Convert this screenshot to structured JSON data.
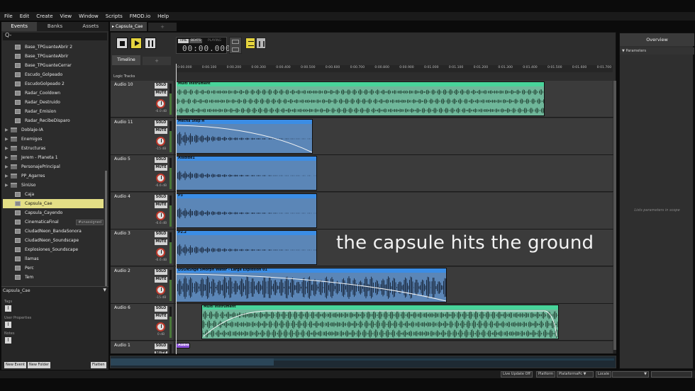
{
  "menu": [
    "File",
    "Edit",
    "Create",
    "View",
    "Window",
    "Scripts",
    "FMOD.io",
    "Help"
  ],
  "left_tabs": [
    "Events",
    "Banks",
    "Assets"
  ],
  "search_glyph": "Q-",
  "tree": [
    {
      "label": "Base_TPGuanteAbrir 2",
      "kind": "event"
    },
    {
      "label": "Base_TPGuanteAbrir",
      "kind": "event"
    },
    {
      "label": "Base_TPGuanteCerrar",
      "kind": "event"
    },
    {
      "label": "Escudo_Golpeado",
      "kind": "event"
    },
    {
      "label": "EscudoGolpeado 2",
      "kind": "event"
    },
    {
      "label": "Radar_Cooldown",
      "kind": "event"
    },
    {
      "label": "Radar_Destruido",
      "kind": "event"
    },
    {
      "label": "Radar_Emision",
      "kind": "event"
    },
    {
      "label": "Radar_RecibeDisparo",
      "kind": "event"
    },
    {
      "label": "Doblaje-IA",
      "kind": "folder"
    },
    {
      "label": "Enemigos",
      "kind": "folder"
    },
    {
      "label": "Estructuras",
      "kind": "folder"
    },
    {
      "label": "Jerem - Planeta 1",
      "kind": "folder"
    },
    {
      "label": "PersonajePrincipal",
      "kind": "folder"
    },
    {
      "label": "PP_Agarres",
      "kind": "folder"
    },
    {
      "label": "SinUso",
      "kind": "folder"
    },
    {
      "label": "Caja",
      "kind": "event"
    },
    {
      "label": "Capsula_Cae",
      "kind": "event",
      "selected": true
    },
    {
      "label": "Capsula_Cayendo",
      "kind": "event"
    },
    {
      "label": "CinematicaFinal",
      "kind": "event",
      "badge": "#unassigned"
    },
    {
      "label": "CiudadNeon_BandaSonora",
      "kind": "event"
    },
    {
      "label": "CiudadNeon_Soundscape",
      "kind": "event"
    },
    {
      "label": "Explosiones_Soundscape",
      "kind": "event"
    },
    {
      "label": "llamas",
      "kind": "event"
    },
    {
      "label": "Perc",
      "kind": "event"
    },
    {
      "label": "Tem",
      "kind": "event"
    }
  ],
  "props": {
    "title": "Capsula_Cae",
    "tags_label": "Tags",
    "user_props_label": "User Properties",
    "notes_label": "Notes",
    "add_glyph": "I"
  },
  "left_buttons": [
    "New Event",
    "New Folder",
    "Flatten"
  ],
  "editor": {
    "tab_label": "Capsula_Cae",
    "add_tab_glyph": "+",
    "time_tags": [
      "TIME",
      "BEATS",
      "PLAYING"
    ],
    "time_value": "00:00.000",
    "subtab": "Timeline",
    "logic_tracks_label": "Logic Tracks",
    "ruler": [
      "0:00.000",
      "0:00.100",
      "0:00.200",
      "0:00.300",
      "0:00.400",
      "0:00.500",
      "0:00.600",
      "0:00.700",
      "0:00.800",
      "0:00.900",
      "0:01.000",
      "0:01.100",
      "0:01.200",
      "0:01.300",
      "0:01.400",
      "0:01.500",
      "0:01.600",
      "0:01.700"
    ],
    "solo_label": "SOLO",
    "mute_label": "MUTE",
    "tracks": [
      {
        "name": "Audio 10",
        "db": "-6.0 dB",
        "instrument": "Multi Instrument",
        "color": "green"
      },
      {
        "name": "Audio 11",
        "db": "-15 dB",
        "instrument": "Mecha Step H",
        "color": "blue"
      },
      {
        "name": "Audio 5",
        "db": "-6.6 dB",
        "instrument": "Aladide1",
        "color": "blue"
      },
      {
        "name": "Audio 4",
        "db": "-6.6 dB",
        "instrument": "P3",
        "color": "blue"
      },
      {
        "name": "Audio 3",
        "db": "-6.6 dB",
        "instrument": "P2.2",
        "color": "blue"
      },
      {
        "name": "Audio 2",
        "db": "-15 dB",
        "instrument": "DSGNSnge 5Morph Water - Large Explosion 01",
        "color": "blue"
      },
      {
        "name": "Audio 6",
        "db": "0 dB",
        "instrument": "Multi Instrument",
        "color": "green"
      },
      {
        "name": "Audio 1",
        "db": "",
        "instrument": "Audio",
        "color": "purple"
      }
    ]
  },
  "caption": "the capsule hits the ground",
  "overview": {
    "title": "Overview",
    "params_label": "Parameters",
    "empty_msg": "Lists parameters in scope"
  },
  "status": {
    "live_update": "Live Update Off",
    "platform_label": "Platform",
    "platform_value": "PlataformaPc",
    "locale_label": "Locale"
  },
  "colors": {
    "accent": "#e4df86",
    "green_track": "#48d49a",
    "blue_track": "#3b8de5",
    "play": "#e4d33e"
  }
}
